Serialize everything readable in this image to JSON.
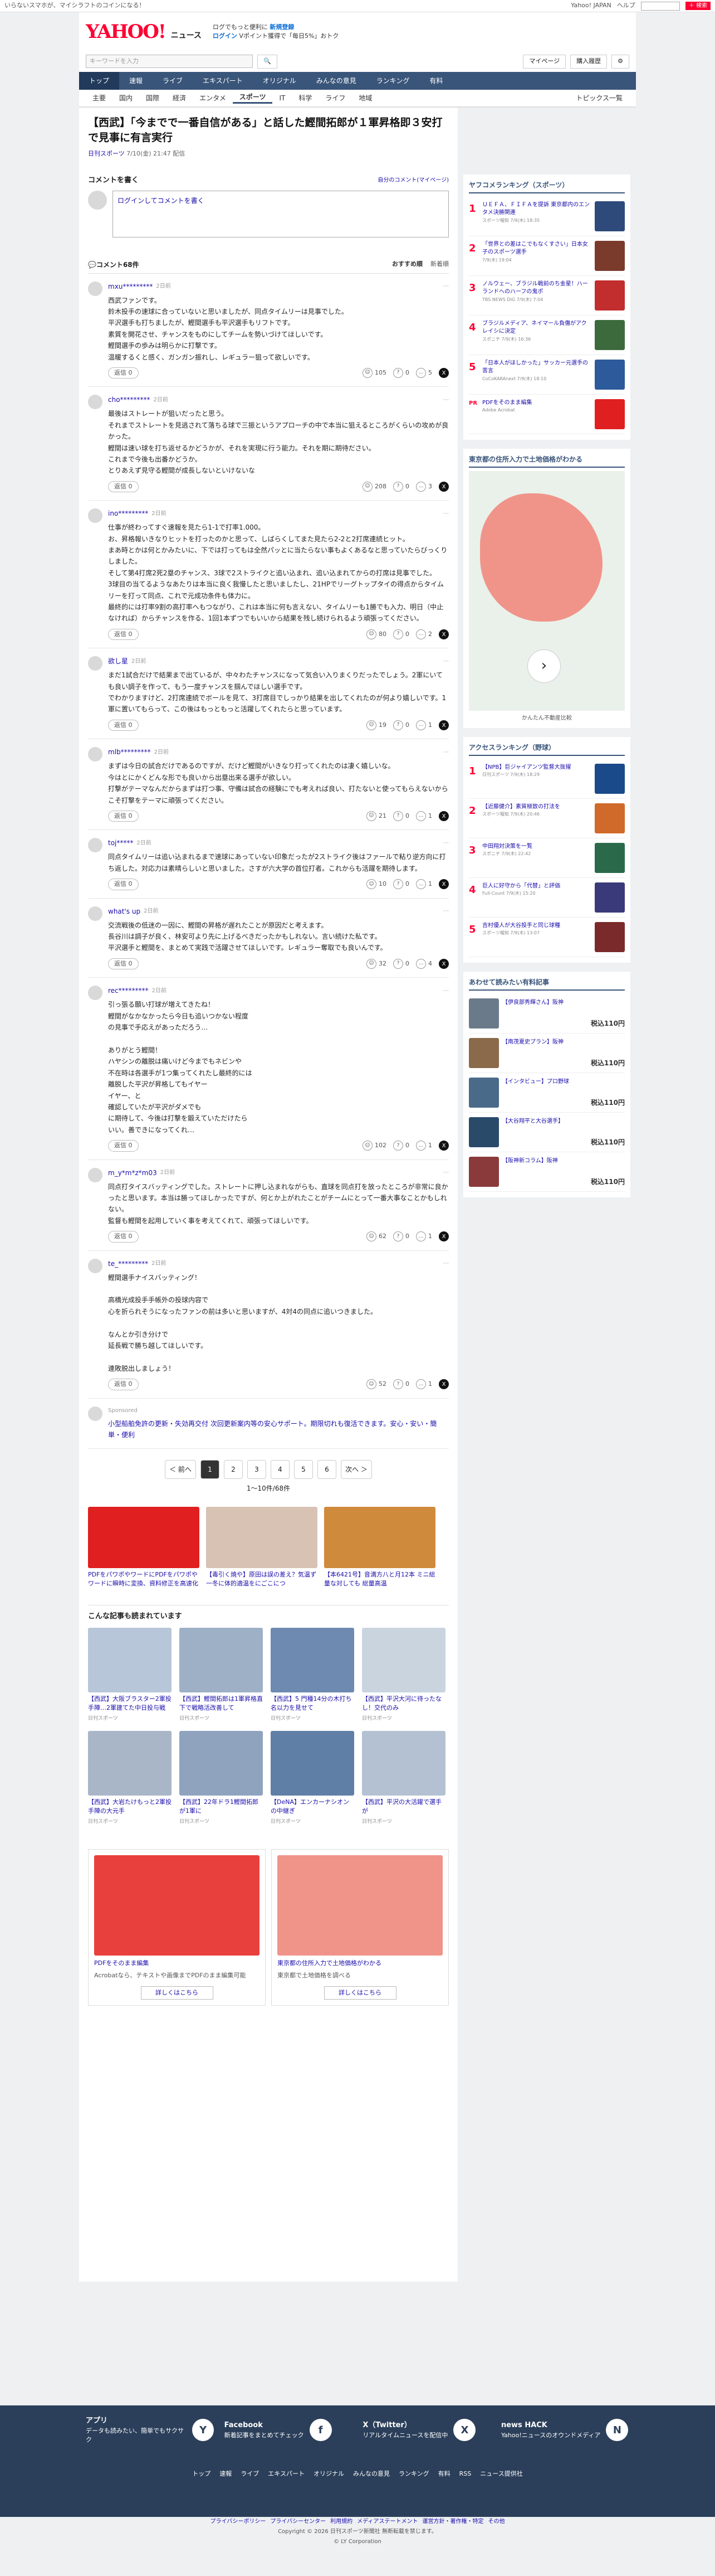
{
  "topbar": {
    "left": "いらないスマホが、マイシラフトのコインになる！",
    "links": [
      "Yahoo! JAPAN",
      "ヘルプ"
    ],
    "search_placeholder": "ウェブ検索",
    "search_btn": "＋ 検索"
  },
  "header": {
    "logo": "YAHOO!",
    "logo_sub": "ニュース",
    "promo_line1": "ログでもっと便利に",
    "promo_link1": "新規登録",
    "promo_line2": "ログイン",
    "promo_link2": "Vポイント獲得で「毎日5%」おトク"
  },
  "searchrow": {
    "placeholder": "キーワードを入力",
    "mypage": "マイページ",
    "setting": "購入履歴"
  },
  "nav1": [
    "トップ",
    "速報",
    "ライブ",
    "エキスパート",
    "オリジナル",
    "みんなの意見",
    "ランキング",
    "有料"
  ],
  "nav2": [
    "主要",
    "国内",
    "国際",
    "経済",
    "エンタメ",
    "スポーツ",
    "IT",
    "科学",
    "ライフ",
    "地域"
  ],
  "nav2_right": "トピックス一覧",
  "article": {
    "title": "【西武】「今までで一番自信がある」と話した鰹間拓郎が１軍昇格即３安打で見事に有言実行",
    "source": "日刊スポーツ",
    "time": "7/10(金) 21:47 配信"
  },
  "comment_box": {
    "title": "コメントを書く",
    "my_link": "自分のコメント(マイページ)",
    "placeholder": "ログインしてコメントを書く"
  },
  "comment_count": "コメント68件",
  "sort_tabs": [
    "おすすめ順",
    "新着順"
  ],
  "comments": [
    {
      "user": "mxu*********",
      "time": "2日前",
      "text": "西武ファンです。\n鈴木投手の速球に合っていないと思いましたが、同点タイムリーは見事でした。\n平沢選手も打ちましたが、鰹間選手も平沢選手もリフトです。\n素質を開花させ、チャンスをものにしてチームを勢いづけてほしいです。\n鰹間選手の歩みは明らかに打撃です。\n温暖するくと感く、ガンガン振れし、レギュラー狙って欲しいです。",
      "reply": "返信 0",
      "r1": "105",
      "r2": "0",
      "r3": "5"
    },
    {
      "user": "cho*********",
      "time": "2日前",
      "text": "最後はストレートが狙いだったと思う。\nそれまでストレートを見逃されて落ちる球で三振というアプローチの中で本当に狙えるところがくらいの攻めが良かった。\n鰹間は速い球を打ち返せるかどうかが、それを実現に行う能力。それを期に期待ださい。\nこれまで今後も出番かどうか。\nとりあえず見守る鰹間が成長しないといけないな",
      "reply": "返信 0",
      "r1": "208",
      "r2": "0",
      "r3": "3"
    },
    {
      "user": "ino*********",
      "time": "2日前",
      "text": "仕事が終わってすぐ速報を見たら1-1で打率1.000。\nお、昇格報いきなりヒットを打ったのかと思って、しばらくしてまた見たら2-2と2打席連続ヒット。\nまあ時とかは何とかみたいに、下では打ってもは全然パッとに当たらない事もよくあるなと思っていたらびっくりしました。\nそして第4打席2死2塁のチャンス、3球で2ストライクと追い込まれ、追い込まれてからの打席は見事でした。\n3球目の当てるようなあたりは本当に良く我慢したと思いましたし、21HPでリーグトップタイの得点からタイムリーを打って同点、これで元成功条件も体力に。\n最終的には打率9割の高打率へもつながり、これは本当に何も言えない、タイムリーも1勝でも入力、明日（中止なければ）からチャンスを作る、1回1本ずつでもいいから結果を残し続けられるよう頑張ってください。",
      "reply": "返信 0",
      "r1": "80",
      "r2": "0",
      "r3": "2"
    },
    {
      "user": "欲し星",
      "time": "2日前",
      "text": "まだ1試合だけで結果まで出ているが、中々わたチャンスになって気合い入りまくりだったでしょう。2軍にいても良い調子を作って、もう一度チャンスを掴んでほしい選手です。\nでわかりますけど、2打席連続でボールを見て、3打席目でしっかり結果を出してくれたのが何より嬉しいです。1軍に置いてもらって、この後はもっともっと活躍してくれたらと思っています。",
      "reply": "返信 0",
      "r1": "19",
      "r2": "0",
      "r3": "1"
    },
    {
      "user": "mlb*********",
      "time": "2日前",
      "text": "まずは今日の試合だけであるのですが、だけど鰹間がいきなり打ってくれたのは凄く嬉しいな。\n今はとにかくどんな形でも良いから出塁出来る選手が欲しい。\n打撃がテーマなんだからまずは打つ事、守備は試合の経験にでも考えれば良い、打たないと使ってもらえないからこそ打撃をテーマに頑張ってください。",
      "reply": "返信 0",
      "r1": "21",
      "r2": "0",
      "r3": "1"
    },
    {
      "user": "toj*****",
      "time": "2日前",
      "text": "同点タイムリーは追い込まれるまで速球にあっていない印象だったが2ストライク後はファールで粘り逆方向に打ち返した。対応力は素晴らしいと思いました。さすが六大学の首位打者。これからも活躍を期待します。",
      "reply": "返信 0",
      "r1": "10",
      "r2": "0",
      "r3": "1"
    },
    {
      "user": "what's up",
      "time": "2日前",
      "text": "交流戦後の低迷の一因に、鰹間の昇格が遅れたことが原因だと考えます。\n長谷川は調子が良く、林安可より先に上げるべきだったかもしれない。言い続けた私です。\n平沢選手と鰹間を、まとめて実践で活躍させてほしいです。レギュラー奪取でも良いんです。",
      "reply": "返信 0",
      "r1": "32",
      "r2": "0",
      "r3": "4"
    },
    {
      "user": "rec*********",
      "time": "2日前",
      "text": "引っ張る願い打球が増えてきたね！\n鰹間がなかなかったら今日も追いつかない程度\nの見事で手応えがあっただろう…\n\nありがとう鰹間！\nハヤシンの離脱は痛いけど今までもネビンや\n不在時は各選手が1つ集ってくれたし最終的には\n離脱した平沢が昇格してもイヤー\nイヤー、と\n確認していたが平沢がダメでも\nに期待して、今後は打撃を鍛えていただけたら\nいい。善できになってくれ…",
      "reply": "返信 0",
      "r1": "102",
      "r2": "0",
      "r3": "1"
    },
    {
      "user": "m_y*m*z*m03",
      "time": "2日前",
      "text": "同点打タイスバッティングでした。ストレートに押し込まれながらも、直球を同点打を放ったところが非常に良かったと思います。本当は勝ってほしかったですが、何とか上がれたことがチームにとって一番大事なことかもしれない。\n監督も鰹間を起用していく事を考えてくれて、頑張ってほしいです。",
      "reply": "返信 0",
      "r1": "62",
      "r2": "0",
      "r3": "1"
    },
    {
      "user": "te_*********",
      "time": "2日前",
      "text": "鰹間選手ナイスバッティング！\n\n高橋光成投手手帳外の投球内容で\n心を折られそうになったファンの前は多いと思いますが、4対4の同点に追いつきました。\n\nなんとか引き分けで\n延長戦で勝ち越してほしいです。\n\n連敗脱出しましょう！",
      "reply": "返信 0",
      "r1": "52",
      "r2": "0",
      "r3": "1"
    }
  ],
  "sponsored": {
    "label": "Sponsored",
    "text": "小型船舶免許の更新・失効再交付 次回更新案内等の安心サポート。期限切れも復活できます。安心・安い・簡単・便利"
  },
  "pager": {
    "prev": "＜ 前へ",
    "pages": [
      "1",
      "2",
      "3",
      "4",
      "5",
      "6"
    ],
    "next": "次へ ＞",
    "count": "1〜10件/68件"
  },
  "ads": [
    {
      "text": "PDFをパワポやワードにPDFをパワポやワードに瞬時に変換、資料修正を高速化",
      "src": "Adobe Acrobat",
      "color": "#e02020"
    },
    {
      "text": "【毒引く焼や】原田は誤の差え？気温ず一冬に体的適温をにごこにつ",
      "src": "",
      "color": "#d7c2b4"
    },
    {
      "text": "【本6421号】音満方八と月12本 ミニ総量な対しても 総量高温",
      "src": "",
      "color": "#cf8a3c"
    }
  ],
  "related_title": "こんな記事も読まれています",
  "related": [
    {
      "text": "【西武】大阪ブラスター2軍投手陣…2軍建てた中日投与戦",
      "src": "日刊スポーツ",
      "c": "#b7c6d8"
    },
    {
      "text": "【西武】鰹間拓郎は1軍昇格直下で戦略活改善して",
      "src": "日刊スポーツ",
      "c": "#9db0c6"
    },
    {
      "text": "【西武】5 門種14分の木打ち 名以力を見せて",
      "src": "日刊スポーツ",
      "c": "#6e8ab0"
    },
    {
      "text": "【西武】平沢大河に待ったなし！交代のみ",
      "src": "日刊スポーツ",
      "c": "#c9d4df"
    },
    {
      "text": "【西武】大岩たけもっと2軍投手陣の大元手",
      "src": "日刊スポーツ",
      "c": "#a9b6c7"
    },
    {
      "text": "【西武】22年ドラ1鰹間拓郎が1軍に",
      "src": "日刊スポーツ",
      "c": "#8fa3be"
    },
    {
      "text": "【DeNA】エンカーナシオンの中継ぎ",
      "src": "日刊スポーツ",
      "c": "#5f7fa6"
    },
    {
      "text": "【西武】平沢の大活躍で選手が",
      "src": "日刊スポーツ",
      "c": "#b4c1d2"
    }
  ],
  "bottom_ads": [
    {
      "title": "PDFをそのまま編集",
      "desc": "Acrobatなら、テキストや画像までPDFのまま編集可能",
      "src": "Adobe Acrobat",
      "cta": "詳しくはこちら",
      "c": "#e8403c"
    },
    {
      "title": "東京都の住所入力で土地価格がわかる",
      "desc": "東京都で土地価格を調べる",
      "src": "",
      "cta": "詳しくはこちら",
      "c": "#f0948a"
    }
  ],
  "side": {
    "rank_title": "ヤフコメランキング（スポーツ）",
    "ranks": [
      {
        "n": "1",
        "t": "ＵＥＦＡ、ＦＩＦＡを提訴 東京都内のエンタメ決勝関連",
        "s": "スポーツ報知 7/9(木) 18:35",
        "c": "#2d4a7a"
      },
      {
        "n": "2",
        "t": "「世界との差はこでもなくすさい」日本女子のスポーツ選手",
        "s": "7/9(木) 19:04",
        "c": "#7a3b2d"
      },
      {
        "n": "3",
        "t": "ノルウェー、ブラジル戦前のち金星！ハーランドへのハーフの鬼ポ",
        "s": "TBS NEWS DIG 7/9(木) 7:04",
        "c": "#c22d2d"
      },
      {
        "n": "4",
        "t": "ブラジルメディア、ネイマール負傷がアクレイシに決定",
        "s": "スポニチ 7/9(木) 16:36",
        "c": "#3d6a3d"
      },
      {
        "n": "5",
        "t": "「日本人がほしかった」サッカー元選手の苦言",
        "s": "CoCoKARAnext 7/9(木) 18:10",
        "c": "#2d5a9a"
      }
    ],
    "pr": "PDFをそのまま編集",
    "pr_src": "Adobe Acrobat",
    "map_title": "東京都の住所入力で土地価格がわかる",
    "map_cap": "かんたん不動産比較",
    "access_title": "アクセスランキング（野球）",
    "access": [
      {
        "n": "1",
        "t": "【NPB】巨ジャイアンツ監督大抜擢",
        "s": "日刊スポーツ 7/9(木) 18:29",
        "c": "#1a4a8a"
      },
      {
        "n": "2",
        "t": "【近藤健介】素質極致の打法を",
        "s": "スポーツ報知 7/9(木) 20:46",
        "c": "#d06a2a"
      },
      {
        "n": "3",
        "t": "中田翔対決策を一覧",
        "s": "スポニチ 7/9(木) 22:42",
        "c": "#2a6a4a"
      },
      {
        "n": "4",
        "t": "巨人に好守から「代替」と評価",
        "s": "Full-Count 7/9(木) 15:20",
        "c": "#3a3a7a"
      },
      {
        "n": "5",
        "t": "吉村優人が大谷投手と同じ球種",
        "s": "スポーツ報知 7/9(木) 13:07",
        "c": "#7a2a2a"
      }
    ],
    "shop_title": "あわせて読みたい有料記事",
    "shop": [
      {
        "t": "【伊良部秀輝さん】阪神",
        "price": "税込110円",
        "c": "#6a7a8a"
      },
      {
        "t": "【南茂夏史プラン】阪神",
        "price": "税込110円",
        "c": "#8a6a4a"
      },
      {
        "t": "【インタビュー】プロ野球",
        "price": "税込110円",
        "c": "#4a6a8a"
      },
      {
        "t": "【大谷翔平と大谷選手】",
        "price": "税込110円",
        "c": "#2a4a6a"
      },
      {
        "t": "【阪神新コラム】阪神",
        "price": "税込110円",
        "c": "#8a3a3a"
      }
    ]
  },
  "footer": {
    "items": [
      {
        "t": "アプリ",
        "d": "データも読みたい、簡単でもサクサク",
        "i": "Y"
      },
      {
        "t": "Facebook",
        "d": "新着記事をまとめてチェック",
        "i": "f"
      },
      {
        "t": "X（Twitter）",
        "d": "リアルタイムニュースを配信中",
        "i": "X"
      },
      {
        "t": "news HACK",
        "d": "Yahoo!ニュースのオウンドメディア",
        "i": "N"
      }
    ],
    "links": [
      "トップ",
      "速報",
      "ライブ",
      "エキスパート",
      "オリジナル",
      "みんなの意見",
      "ランキング",
      "有料",
      "RSS",
      "ニュース提供社"
    ],
    "policy": [
      "プライバシーポリシー",
      "プライバシーセンター",
      "利用規約",
      "メディアステートメント",
      "運営方針・著作権・特定",
      "その他"
    ],
    "copy": "Copyright © 2026 日刊スポーツ新聞社 無断転載を禁じます。",
    "corp": "© LY Corporation"
  }
}
